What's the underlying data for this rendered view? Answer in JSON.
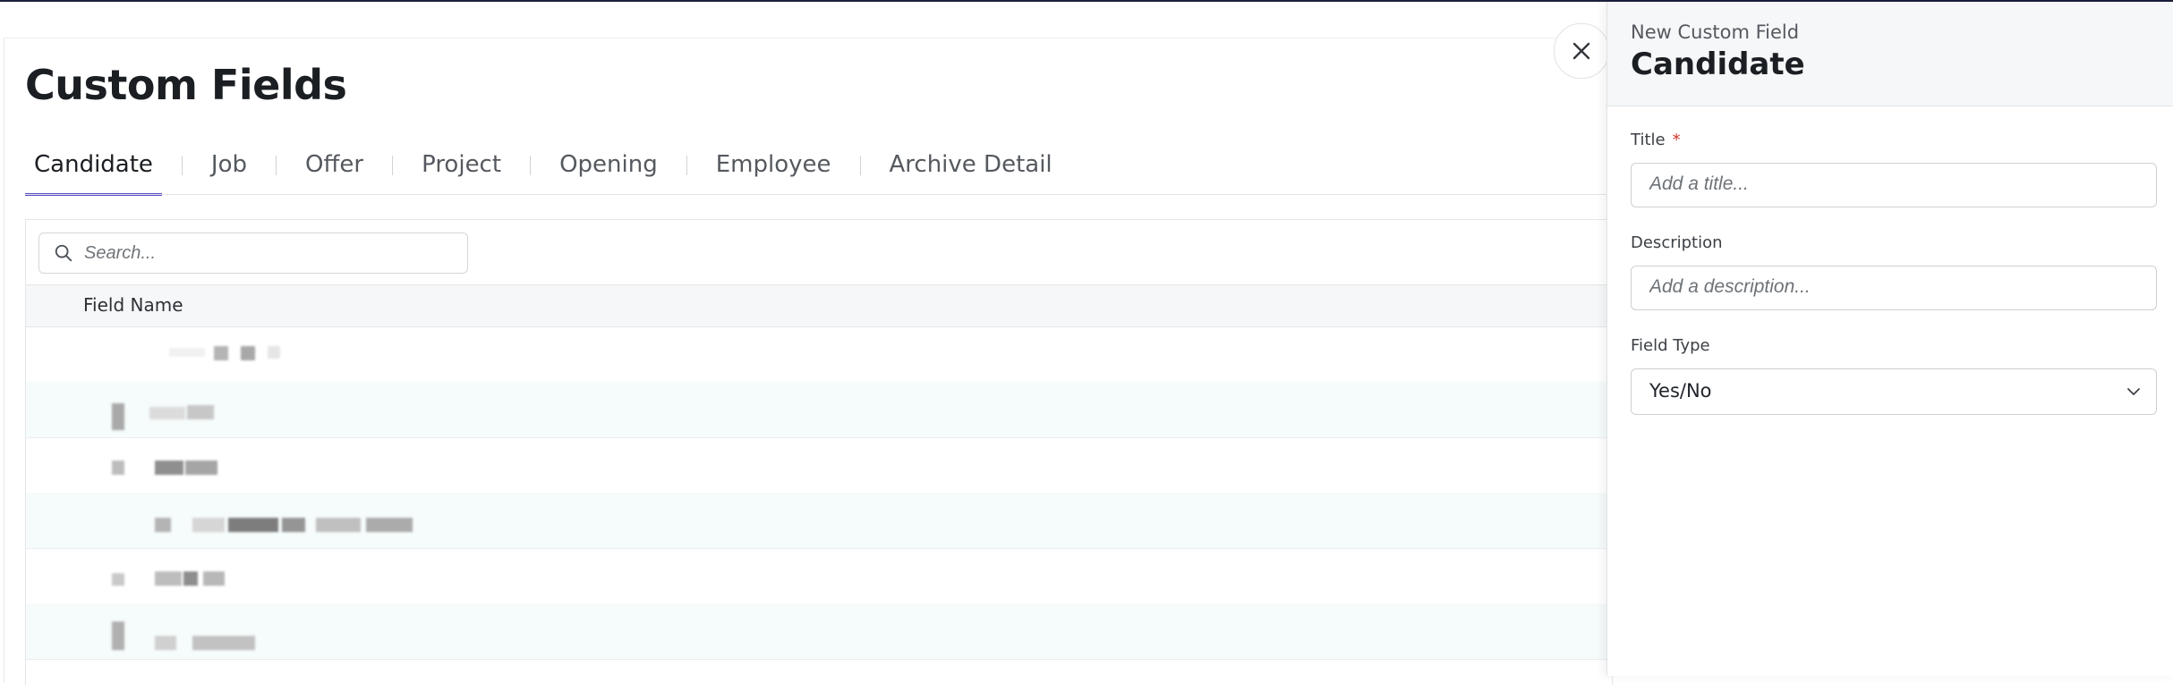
{
  "page": {
    "title": "Custom Fields"
  },
  "tabs": [
    {
      "label": "Candidate",
      "active": true
    },
    {
      "label": "Job",
      "active": false
    },
    {
      "label": "Offer",
      "active": false
    },
    {
      "label": "Project",
      "active": false
    },
    {
      "label": "Opening",
      "active": false
    },
    {
      "label": "Employee",
      "active": false
    },
    {
      "label": "Archive Detail",
      "active": false
    }
  ],
  "search": {
    "placeholder": "Search..."
  },
  "table": {
    "column_header": "Field Name",
    "rows": [
      "",
      "",
      "",
      "",
      "",
      ""
    ]
  },
  "drawer": {
    "subtitle": "New Custom Field",
    "title": "Candidate",
    "title_field": {
      "label": "Title",
      "required_mark": "*",
      "placeholder": "Add a title..."
    },
    "description_field": {
      "label": "Description",
      "placeholder": "Add a description..."
    },
    "type_field": {
      "label": "Field Type",
      "value": "Yes/No"
    }
  },
  "icons": {
    "close": "close-icon",
    "search": "search-icon",
    "chevron": "chevron-down-icon"
  },
  "colors": {
    "accent": "#5b4ec6",
    "topbar": "#1b1f3b",
    "required": "#d0342c"
  }
}
